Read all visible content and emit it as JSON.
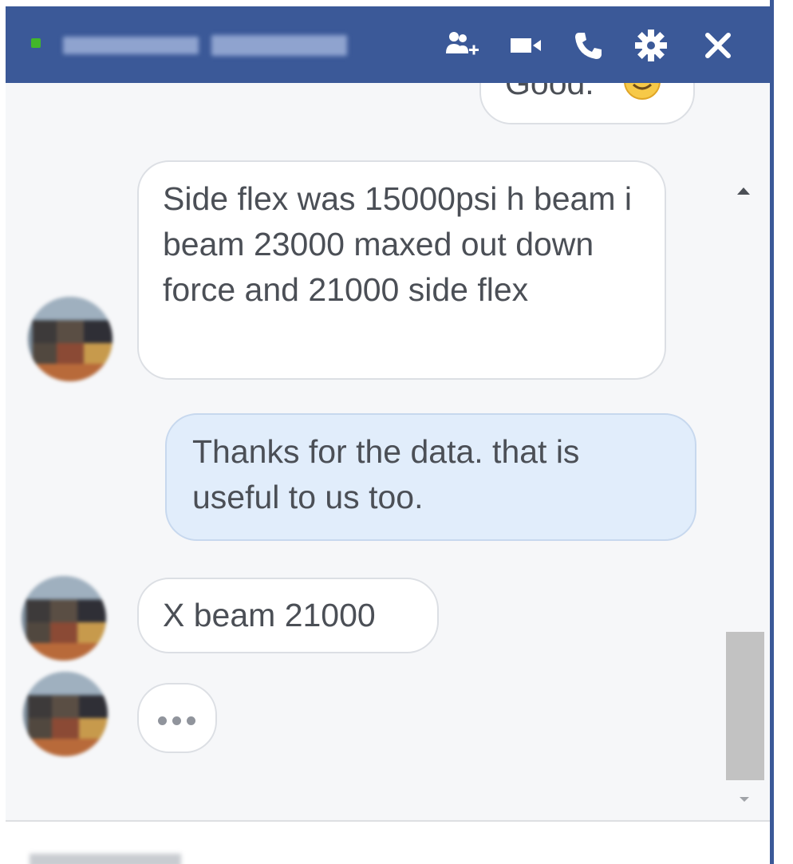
{
  "header": {
    "contact_name": "",
    "online": true,
    "icons": [
      "add-people-icon",
      "video-call-icon",
      "phone-icon",
      "gear-icon",
      "close-icon"
    ],
    "colors": {
      "background": "#3b5998",
      "online_dot": "#42b72a",
      "icon": "#ffffff"
    }
  },
  "conversation": {
    "previous_message": {
      "text": "Good.",
      "emoji": "smiley-emoji-icon",
      "partially_visible": true
    },
    "messages": [
      {
        "sender": "contact",
        "text": "Side flex was 15000psi h beam i beam 23000 maxed out down force and 21000 side flex"
      },
      {
        "sender": "me",
        "text": "Thanks for the data. that is useful to us too."
      },
      {
        "sender": "contact",
        "text": "X beam 21000"
      }
    ],
    "typing_indicator": "typing-dots-icon",
    "colors": {
      "incoming_bubble": "#ffffff",
      "outgoing_bubble": "#e1edfb",
      "text": "#4b4f56"
    }
  },
  "scrollbar": {
    "up_icon": "scroll-up-icon",
    "down_icon": "scroll-down-icon"
  },
  "composer": {
    "placeholder": ""
  }
}
